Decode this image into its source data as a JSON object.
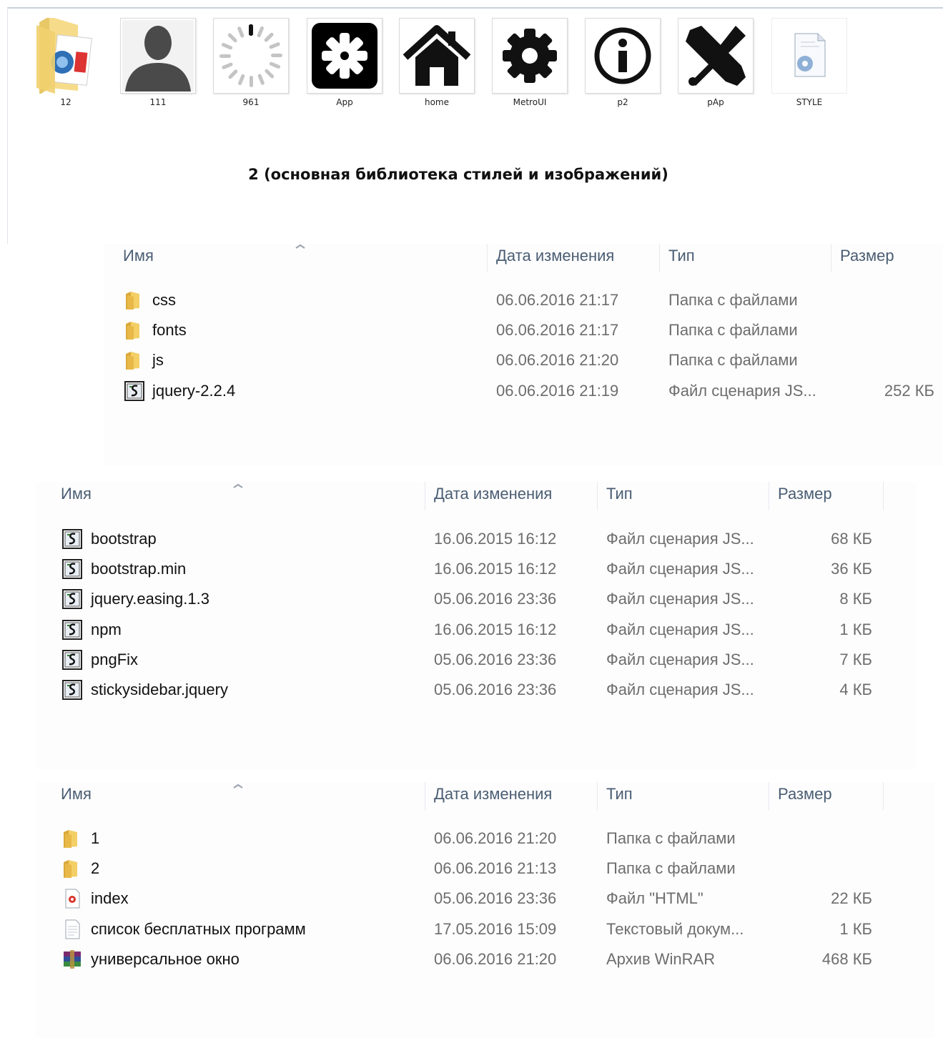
{
  "top_panel": {
    "title": "2 (основная библиотека стилей и изображений)",
    "tiles": [
      {
        "label": "12",
        "icon": "folder-image-icon"
      },
      {
        "label": "111",
        "icon": "user-silhouette-icon"
      },
      {
        "label": "961",
        "icon": "loading-spinner-icon"
      },
      {
        "label": "App",
        "icon": "asterisk-app-icon"
      },
      {
        "label": "home",
        "icon": "home-icon"
      },
      {
        "label": "MetroUI",
        "icon": "gear-icon"
      },
      {
        "label": "p2",
        "icon": "info-icon"
      },
      {
        "label": "pAp",
        "icon": "tools-icon"
      },
      {
        "label": "STYLE",
        "icon": "settings-file-icon"
      }
    ]
  },
  "columns": {
    "name": "Имя",
    "date": "Дата изменения",
    "type": "Тип",
    "size": "Размер"
  },
  "panels": [
    {
      "rows": [
        {
          "name": "css",
          "date": "06.06.2016 21:17",
          "type": "Папка с файлами",
          "size": "",
          "icon": "folder-icon"
        },
        {
          "name": "fonts",
          "date": "06.06.2016 21:17",
          "type": "Папка с файлами",
          "size": "",
          "icon": "folder-icon"
        },
        {
          "name": "js",
          "date": "06.06.2016 21:20",
          "type": "Папка с файлами",
          "size": "",
          "icon": "folder-icon"
        },
        {
          "name": "jquery-2.2.4",
          "date": "06.06.2016 21:19",
          "type": "Файл сценария JS...",
          "size": "252 КБ",
          "icon": "script-file-icon"
        }
      ]
    },
    {
      "rows": [
        {
          "name": "bootstrap",
          "date": "16.06.2015 16:12",
          "type": "Файл сценария JS...",
          "size": "68 КБ",
          "icon": "script-file-icon"
        },
        {
          "name": "bootstrap.min",
          "date": "16.06.2015 16:12",
          "type": "Файл сценария JS...",
          "size": "36 КБ",
          "icon": "script-file-icon"
        },
        {
          "name": "jquery.easing.1.3",
          "date": "05.06.2016 23:36",
          "type": "Файл сценария JS...",
          "size": "8 КБ",
          "icon": "script-file-icon"
        },
        {
          "name": "npm",
          "date": "16.06.2015 16:12",
          "type": "Файл сценария JS...",
          "size": "1 КБ",
          "icon": "script-file-icon"
        },
        {
          "name": "pngFix",
          "date": "05.06.2016 23:36",
          "type": "Файл сценария JS...",
          "size": "7 КБ",
          "icon": "script-file-icon"
        },
        {
          "name": "stickysidebar.jquery",
          "date": "05.06.2016 23:36",
          "type": "Файл сценария JS...",
          "size": "4 КБ",
          "icon": "script-file-icon"
        }
      ]
    },
    {
      "rows": [
        {
          "name": "1",
          "date": "06.06.2016 21:20",
          "type": "Папка с файлами",
          "size": "",
          "icon": "folder-icon"
        },
        {
          "name": "2",
          "date": "06.06.2016 21:13",
          "type": "Папка с файлами",
          "size": "",
          "icon": "folder-icon"
        },
        {
          "name": "index",
          "date": "05.06.2016 23:36",
          "type": "Файл \"HTML\"",
          "size": "22 КБ",
          "icon": "html-file-icon"
        },
        {
          "name": "список бесплатных программ",
          "date": "17.05.2016 15:09",
          "type": "Текстовый докум...",
          "size": "1 КБ",
          "icon": "text-file-icon"
        },
        {
          "name": "универсальное окно",
          "date": "06.06.2016 21:20",
          "type": "Архив WinRAR",
          "size": "468 КБ",
          "icon": "winrar-archive-icon"
        }
      ]
    }
  ]
}
